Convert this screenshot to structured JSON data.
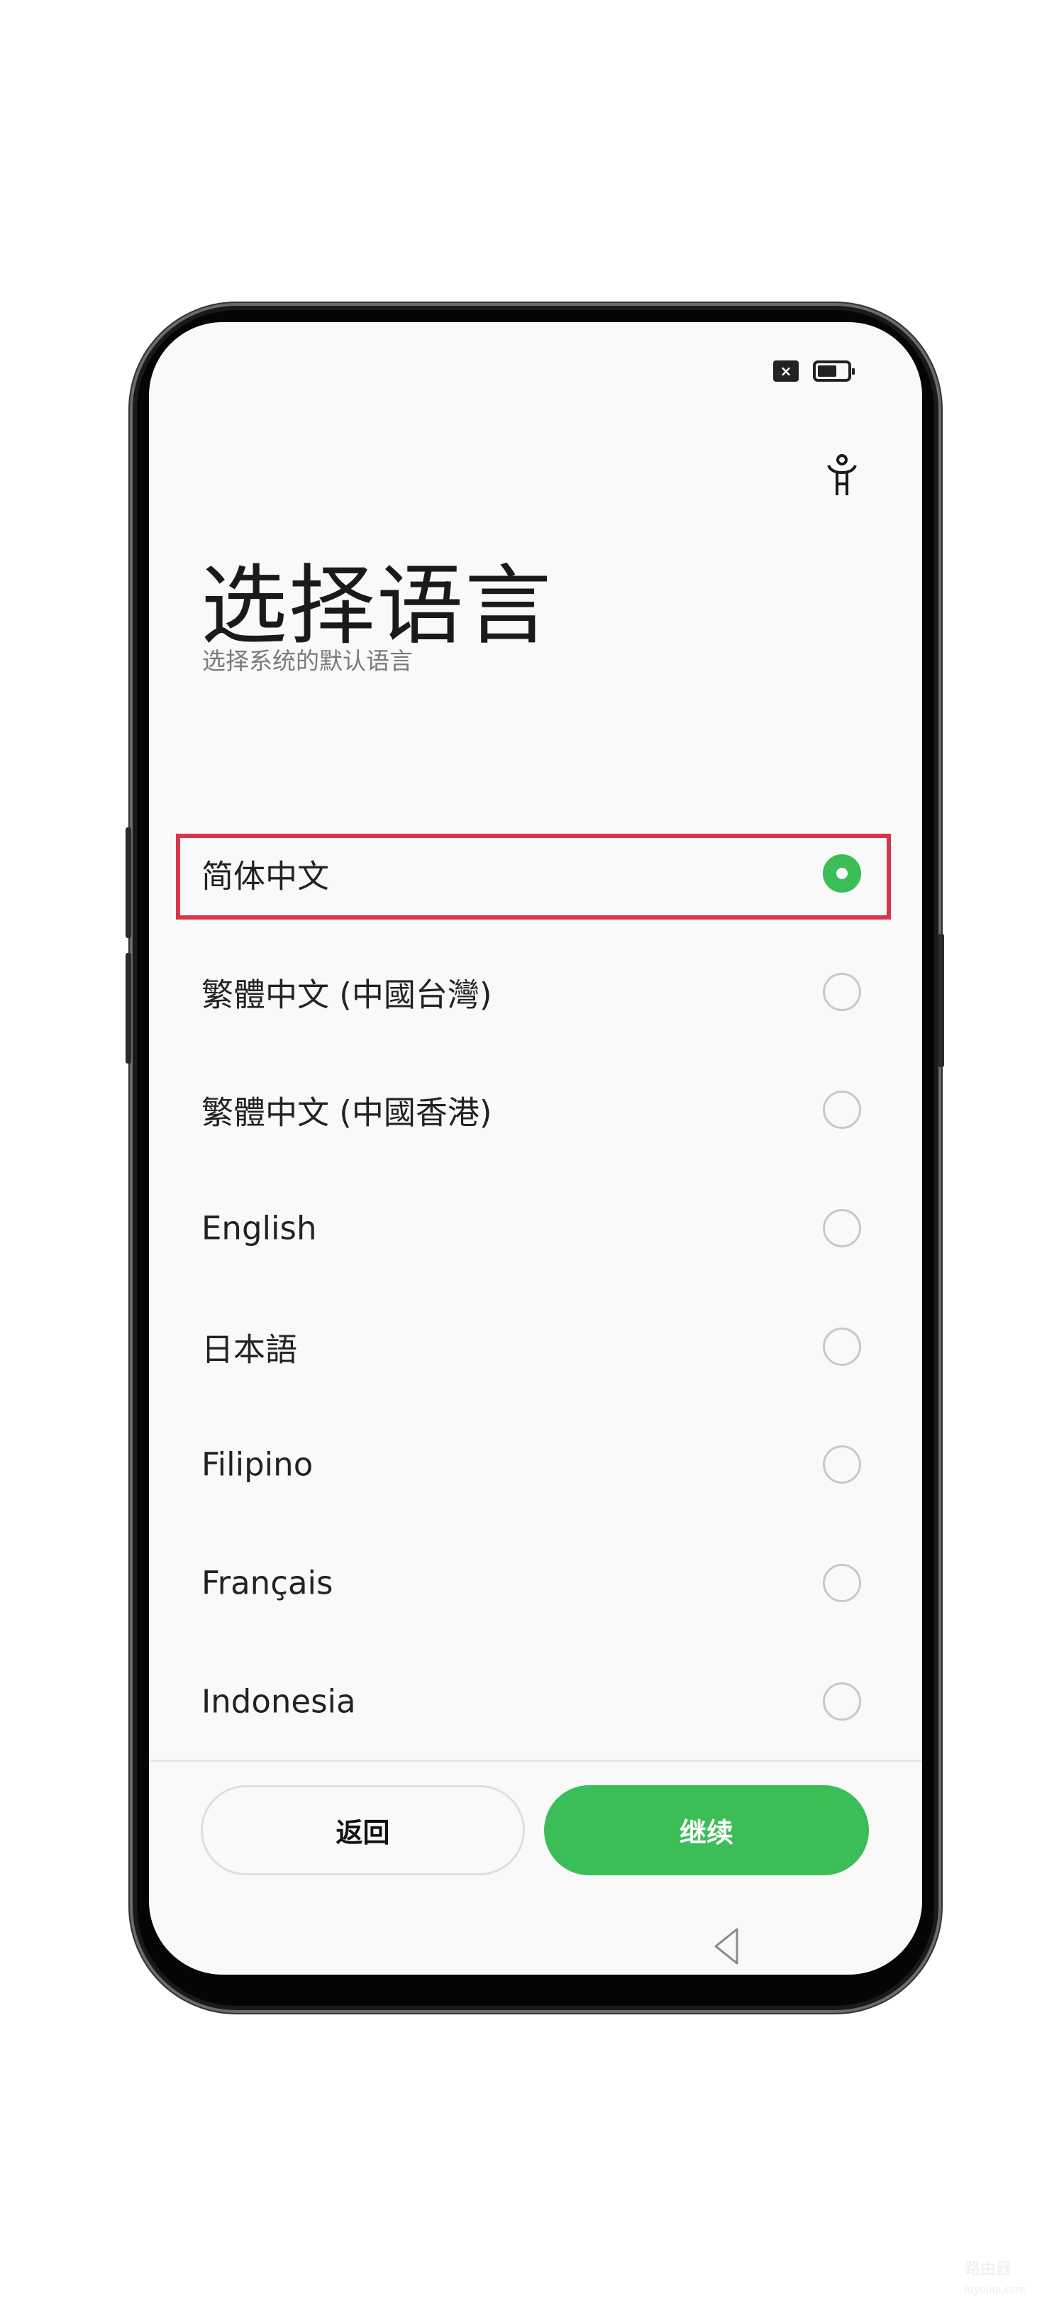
{
  "status_bar": {
    "sim_icon": "sim-card-absent-icon",
    "sim_glyph": "×",
    "battery_icon": "battery-icon",
    "battery_level": 0.55
  },
  "header": {
    "accessibility_icon": "accessibility-icon",
    "title": "选择语言",
    "subtitle": "选择系统的默认语言"
  },
  "languages": [
    {
      "label": "简体中文",
      "selected": true
    },
    {
      "label": "繁體中文 (中國台灣)",
      "selected": false
    },
    {
      "label": "繁體中文 (中國香港)",
      "selected": false
    },
    {
      "label": "English",
      "selected": false
    },
    {
      "label": "日本語",
      "selected": false
    },
    {
      "label": "Filipino",
      "selected": false
    },
    {
      "label": "Français",
      "selected": false
    },
    {
      "label": "Indonesia",
      "selected": false
    }
  ],
  "footer": {
    "back_label": "返回",
    "continue_label": "继续"
  },
  "nav": {
    "back_icon": "nav-back-triangle-icon"
  },
  "watermark": {
    "text": "路由器",
    "subtext": "luyouqi.com"
  },
  "colors": {
    "accent": "#3bbd58",
    "highlight": "#d9344a",
    "text": "#222222",
    "subtitle": "#7a7a7a",
    "background": "#f9f9f9"
  }
}
